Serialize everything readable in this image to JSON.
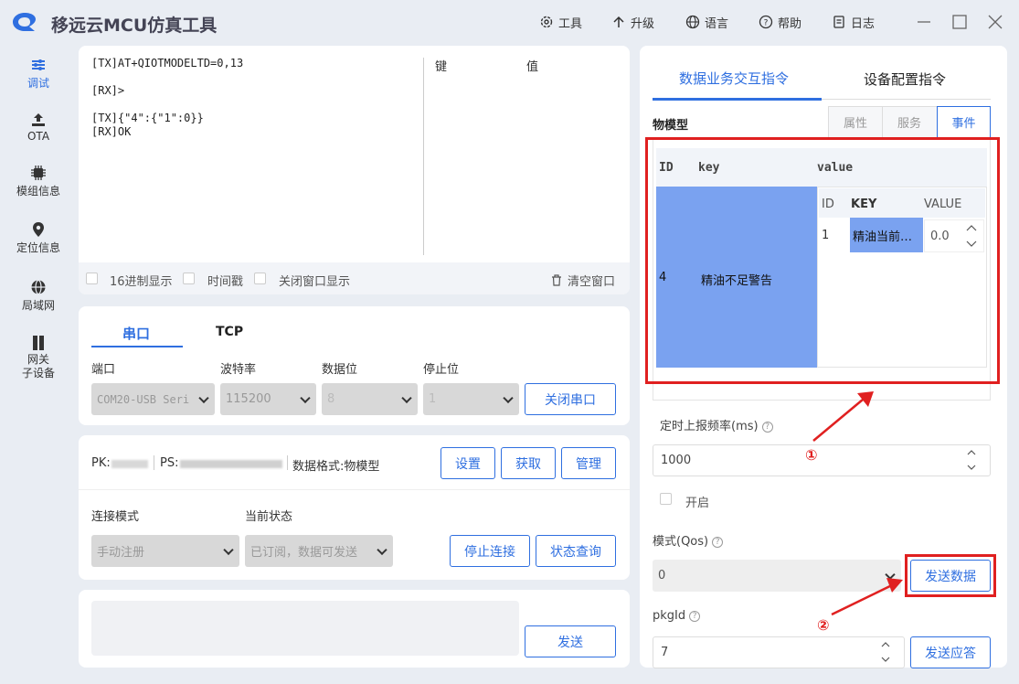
{
  "app": {
    "title": "移远云MCU仿真工具"
  },
  "topbar": {
    "tools": "工具",
    "upgrade": "升级",
    "language": "语言",
    "help": "帮助",
    "log": "日志"
  },
  "sidebar": {
    "items": [
      {
        "label": "调试",
        "icon": "sliders-icon"
      },
      {
        "label": "OTA",
        "icon": "upload-icon"
      },
      {
        "label": "模组信息",
        "icon": "chip-icon"
      },
      {
        "label": "定位信息",
        "icon": "location-icon"
      },
      {
        "label": "局域网",
        "icon": "globe-icon"
      },
      {
        "label": "网关\n子设备",
        "icon": "book-icon"
      }
    ]
  },
  "log": {
    "lines": [
      "[TX]AT+QIOTMODELTD=0,13",
      "[RX]>",
      "[TX]{\"4\":{\"1\":0}}",
      "[RX]OK"
    ],
    "kv_key": "键",
    "kv_value": "值",
    "hex": "16进制显示",
    "timestamp": "时间戳",
    "close_show": "关闭窗口显示",
    "clear": "清空窗口"
  },
  "serial": {
    "tab_serial": "串口",
    "tab_tcp": "TCP",
    "port_label": "端口",
    "baud_label": "波特率",
    "data_label": "数据位",
    "stop_label": "停止位",
    "port": "COM20-USB Seri",
    "baud": "115200",
    "data_bits": "8",
    "stop_bits": "1",
    "close_btn": "关闭串口"
  },
  "device": {
    "pk": "PK:",
    "ps": "PS:",
    "format": "数据格式:物模型",
    "set": "设置",
    "get": "获取",
    "manage": "管理",
    "mode_label": "连接模式",
    "state_label": "当前状态",
    "mode": "手动注册",
    "state": "已订阅，数据可发送",
    "stop": "停止连接",
    "query": "状态查询"
  },
  "send": {
    "button": "发送"
  },
  "right": {
    "tab_data": "数据业务交互指令",
    "tab_config": "设备配置指令",
    "model_label": "物模型",
    "sub_attr": "属性",
    "sub_service": "服务",
    "sub_event": "事件",
    "table_head": {
      "id": "ID",
      "key": "key",
      "value": "value"
    },
    "row": {
      "id": "4",
      "key": "精油不足警告"
    },
    "inner_head": {
      "id": "ID",
      "key": "KEY",
      "value": "VALUE"
    },
    "inner_row": {
      "id": "1",
      "key": "精油当前…",
      "value": "0.0"
    },
    "freq_label": "定时上报频率(ms)",
    "freq": "1000",
    "enable": "开启",
    "qos_label": "模式(Qos)",
    "qos": "0",
    "send_data": "发送数据",
    "pkgid_label": "pkgId",
    "pkgid": "7",
    "send_reply": "发送应答"
  },
  "annotations": {
    "one": "①",
    "two": "②"
  },
  "colors": {
    "accent": "#2f6fe0",
    "highlight": "#7aa2f0",
    "annotation": "#e02020"
  }
}
